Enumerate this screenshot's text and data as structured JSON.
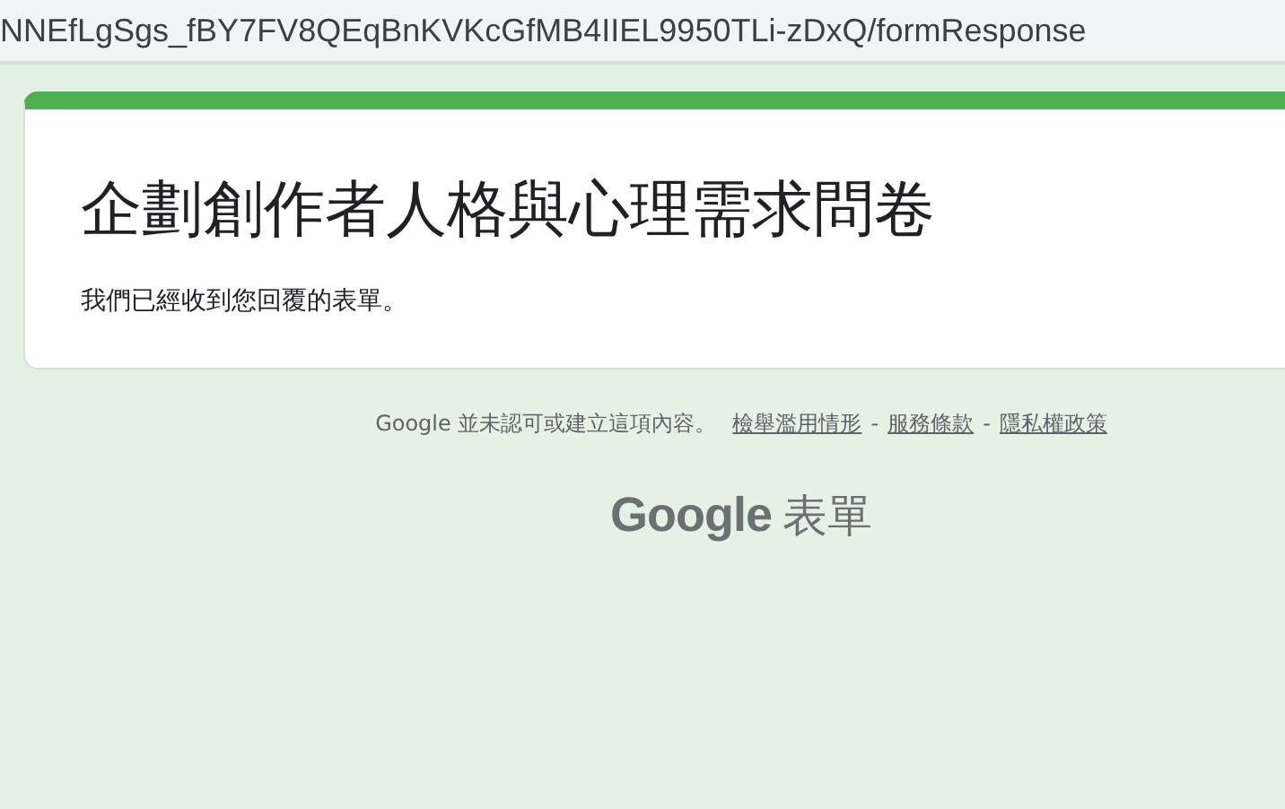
{
  "address_bar": {
    "url": "NNEfLgSgs_fBY7FV8QEqBnKVKcGfMB4IIEL9950TLi-zDxQ/formResponse"
  },
  "form": {
    "title": "企劃創作者人格與心理需求問卷",
    "message": "我們已經收到您回覆的表單。"
  },
  "footer": {
    "disclaimer": "Google 並未認可或建立這項內容。",
    "separator": "-",
    "links": [
      "檢舉濫用情形",
      "服務條款",
      "隱私權政策"
    ]
  },
  "logo": {
    "brand": "Google",
    "product": "表單"
  }
}
